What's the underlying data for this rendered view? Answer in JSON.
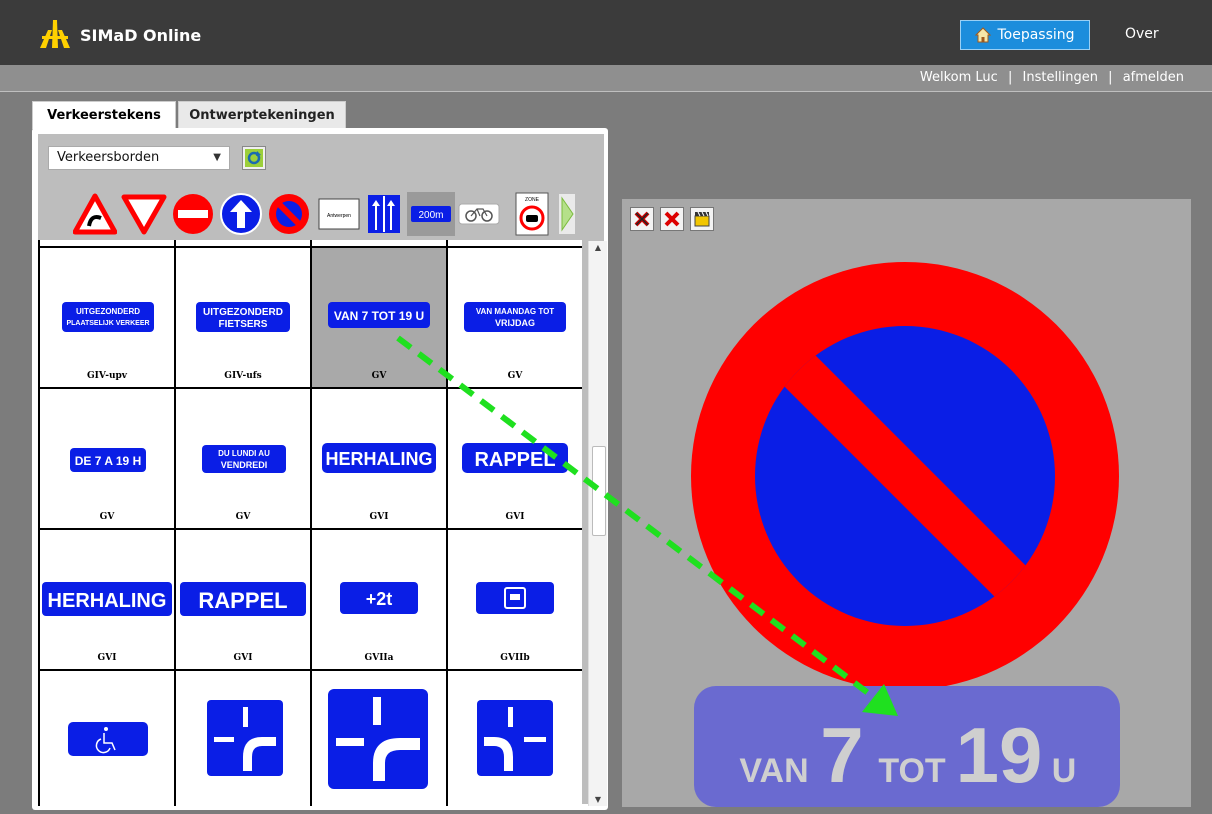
{
  "header": {
    "app_title": "SIMaD Online",
    "toepassing_label": "Toepassing",
    "over_label": "Over",
    "brand_color": "#1c8ddc"
  },
  "userbar": {
    "welcome": "Welkom Luc",
    "sep1": "|",
    "settings": "Instellingen",
    "sep2": "|",
    "logout": "afmelden"
  },
  "tabs": [
    {
      "label": "Verkeerstekens",
      "active": true
    },
    {
      "label": "Ontwerptekeningen",
      "active": false
    }
  ],
  "category_select": {
    "value": "Verkeersborden"
  },
  "sign_grid": {
    "rows": [
      [
        {
          "label": "GIV-upv",
          "sign_text": [
            "UITGEZONDERD",
            "PLAATSELIJK VERKEER"
          ]
        },
        {
          "label": "GIV-ufs",
          "sign_text": [
            "UITGEZONDERD",
            "FIETSERS"
          ]
        },
        {
          "label": "GV",
          "sign_text": [
            "VAN 7 TOT 19 U"
          ],
          "selected": true
        },
        {
          "label": "GV",
          "sign_text": [
            "VAN MAANDAG TOT",
            "VRIJDAG"
          ]
        }
      ],
      [
        {
          "label": "GV",
          "sign_text": [
            "DE 7 A 19 H"
          ]
        },
        {
          "label": "GV",
          "sign_text": [
            "DU LUNDI AU",
            "VENDREDI"
          ]
        },
        {
          "label": "GVI",
          "sign_text": [
            "HERHALING"
          ]
        },
        {
          "label": "GVI",
          "sign_text": [
            "RAPPEL"
          ]
        }
      ],
      [
        {
          "label": "GVI",
          "sign_text": [
            "HERHALING"
          ]
        },
        {
          "label": "GVI",
          "sign_text": [
            "RAPPEL"
          ]
        },
        {
          "label": "GVIIa",
          "sign_text": [
            "+2t"
          ]
        },
        {
          "label": "GVIIb",
          "sign_text": []
        }
      ]
    ]
  },
  "icon_texts": {
    "antwerpen": "Antwerpen",
    "distance": "200m",
    "zone": "ZONE"
  },
  "preview": {
    "sub_sign": {
      "van": "VAN",
      "from": "7",
      "tot": "TOT",
      "to": "19",
      "unit": "U"
    }
  },
  "colors": {
    "sign_blue": "#0a1ee6",
    "sign_red": "#ff0000",
    "arrow_green": "#1fe01f"
  }
}
